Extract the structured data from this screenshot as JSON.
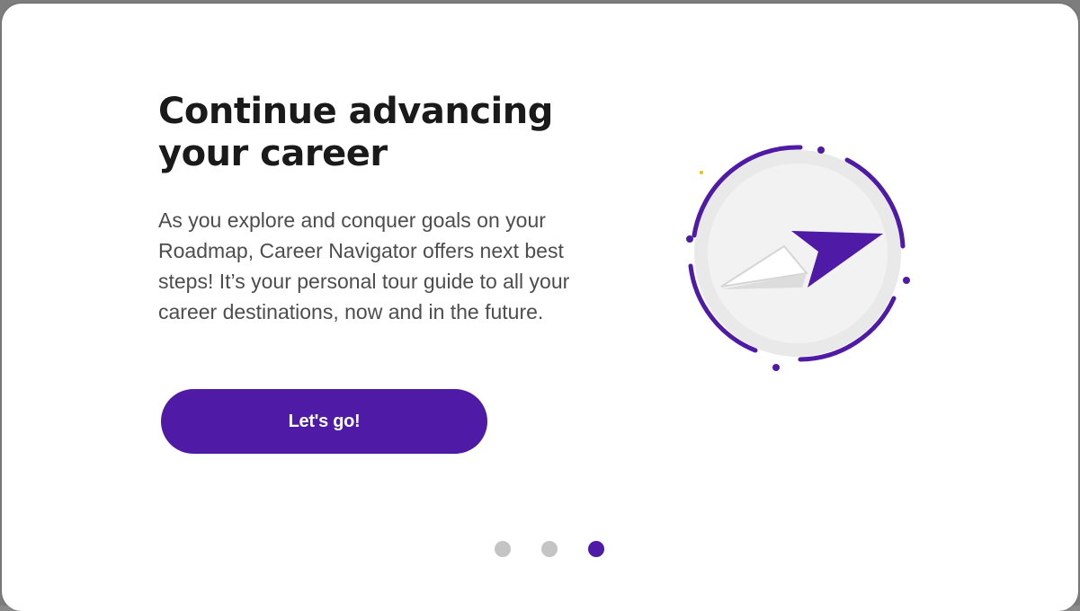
{
  "onboarding": {
    "title": "Continue advancing your career",
    "body": "As you explore and conquer goals on your Roadmap, Career Navigator offers next best steps! It’s your personal tour guide to all your career destinations, now and in the future.",
    "cta_label": "Let's go!",
    "illustration_icon": "compass-arrow-icon",
    "pagination": {
      "total": 3,
      "active": 3
    }
  },
  "colors": {
    "accent": "#4e1aa6",
    "inactive_dot": "#c4c4c4",
    "heading": "#1a1a1a",
    "body": "#4d4d4d"
  }
}
